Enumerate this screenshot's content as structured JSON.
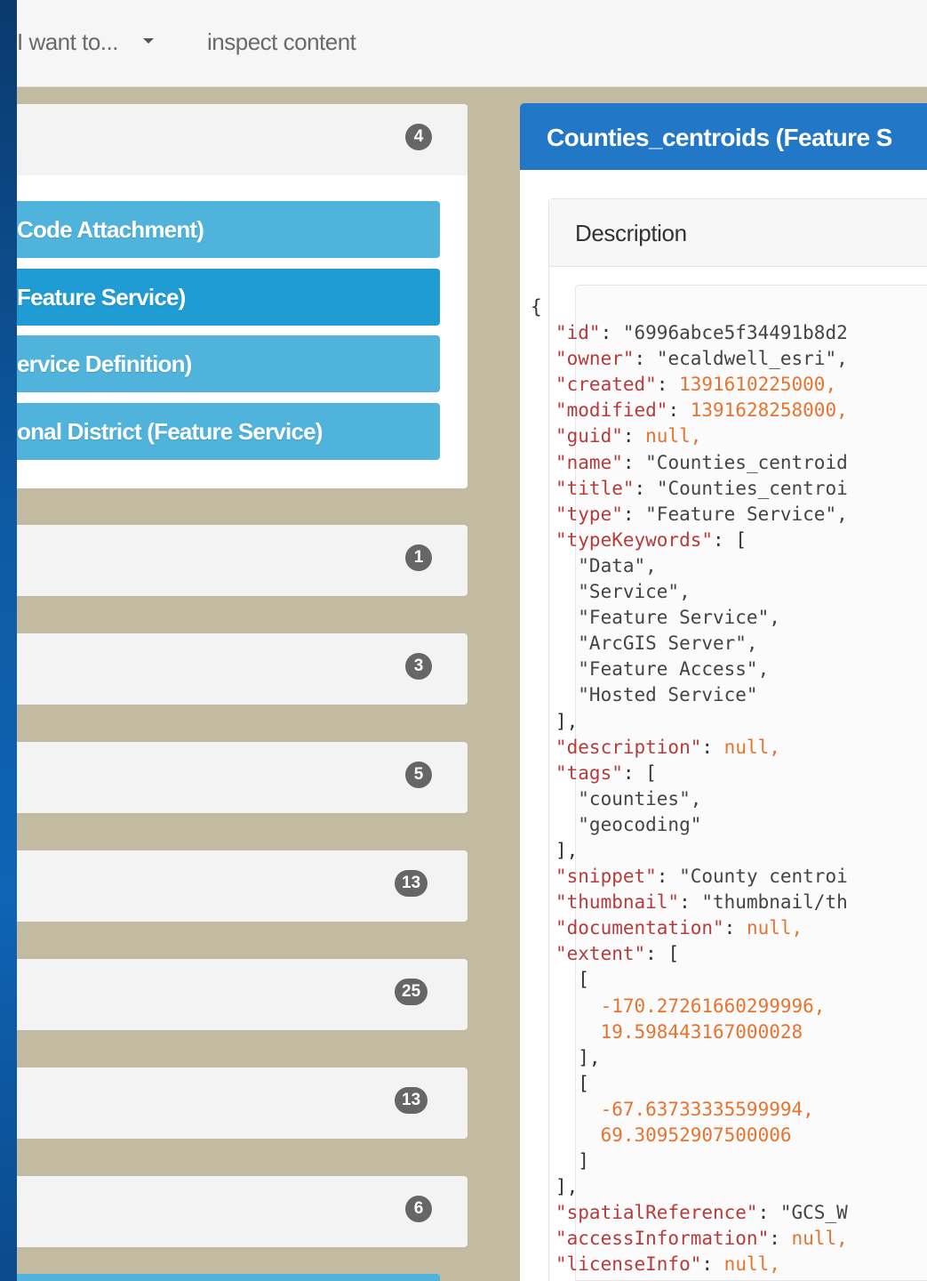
{
  "topbar": {
    "menu_label": "I want to...",
    "inspect_label": "inspect content"
  },
  "item_list": {
    "count": "4",
    "items": [
      {
        "label": "Code Attachment)"
      },
      {
        "label": "Feature Service)"
      },
      {
        "label": "ervice Definition)"
      },
      {
        "label": "onal District (Feature Service)"
      }
    ]
  },
  "groups": [
    {
      "count": "1"
    },
    {
      "count": "3"
    },
    {
      "count": "5"
    },
    {
      "count": "13"
    },
    {
      "count": "25"
    },
    {
      "count": "13"
    },
    {
      "count": "6"
    }
  ],
  "detail": {
    "title": "Counties_centroids (Feature S",
    "section_title": "Description",
    "json_lines": [
      {
        "t": "{",
        "c": "p"
      },
      {
        "k": "\"id\"",
        "v": "\"6996abce5f34491b8d2",
        "vc": "s"
      },
      {
        "k": "\"owner\"",
        "v": "\"ecaldwell_esri\",",
        "vc": "s"
      },
      {
        "k": "\"created\"",
        "v": "1391610225000,",
        "vc": "n"
      },
      {
        "k": "\"modified\"",
        "v": "1391628258000,",
        "vc": "n"
      },
      {
        "k": "\"guid\"",
        "v": "null,",
        "vc": "nl"
      },
      {
        "k": "\"name\"",
        "v": "\"Counties_centroid",
        "vc": "s"
      },
      {
        "k": "\"title\"",
        "v": "\"Counties_centroi",
        "vc": "s"
      },
      {
        "k": "\"type\"",
        "v": "\"Feature Service\",",
        "vc": "s"
      },
      {
        "k": "\"typeKeywords\"",
        "v": "[",
        "vc": "p"
      },
      {
        "t": "  \"Data\",",
        "c": "s",
        "indent": 2
      },
      {
        "t": "  \"Service\",",
        "c": "s",
        "indent": 2
      },
      {
        "t": "  \"Feature Service\",",
        "c": "s",
        "indent": 2
      },
      {
        "t": "  \"ArcGIS Server\",",
        "c": "s",
        "indent": 2
      },
      {
        "t": "  \"Feature Access\",",
        "c": "s",
        "indent": 2
      },
      {
        "t": "  \"Hosted Service\"",
        "c": "s",
        "indent": 2
      },
      {
        "t": "],",
        "c": "p",
        "indent": 1
      },
      {
        "k": "\"description\"",
        "v": "null,",
        "vc": "nl"
      },
      {
        "k": "\"tags\"",
        "v": "[",
        "vc": "p"
      },
      {
        "t": "  \"counties\",",
        "c": "s",
        "indent": 2
      },
      {
        "t": "  \"geocoding\"",
        "c": "s",
        "indent": 2
      },
      {
        "t": "],",
        "c": "p",
        "indent": 1
      },
      {
        "k": "\"snippet\"",
        "v": "\"County centroi",
        "vc": "s"
      },
      {
        "k": "\"thumbnail\"",
        "v": "\"thumbnail/th",
        "vc": "s"
      },
      {
        "k": "\"documentation\"",
        "v": "null,",
        "vc": "nl"
      },
      {
        "k": "\"extent\"",
        "v": "[",
        "vc": "p"
      },
      {
        "t": "  [",
        "c": "p",
        "indent": 2
      },
      {
        "t": "    -170.27261660299996,",
        "c": "n",
        "indent": 3
      },
      {
        "t": "    19.598443167000028",
        "c": "n",
        "indent": 3
      },
      {
        "t": "  ],",
        "c": "p",
        "indent": 2
      },
      {
        "t": "  [",
        "c": "p",
        "indent": 2
      },
      {
        "t": "    -67.63733335599994,",
        "c": "n",
        "indent": 3
      },
      {
        "t": "    69.30952907500006",
        "c": "n",
        "indent": 3
      },
      {
        "t": "  ]",
        "c": "p",
        "indent": 2
      },
      {
        "t": "],",
        "c": "p",
        "indent": 1
      },
      {
        "k": "\"spatialReference\"",
        "v": "\"GCS_W",
        "vc": "s"
      },
      {
        "k": "\"accessInformation\"",
        "v": "null,",
        "vc": "nl"
      },
      {
        "k": "\"licenseInfo\"",
        "v": "null,",
        "vc": "nl"
      }
    ]
  },
  "colors": {
    "background": "#c2bba2",
    "accent_blue": "#2277c7",
    "item_blue": "#4fb3dc",
    "item_active": "#1f9cd3",
    "badge": "#666666",
    "json_key": "#b83b3b",
    "json_number": "#e6732e"
  }
}
